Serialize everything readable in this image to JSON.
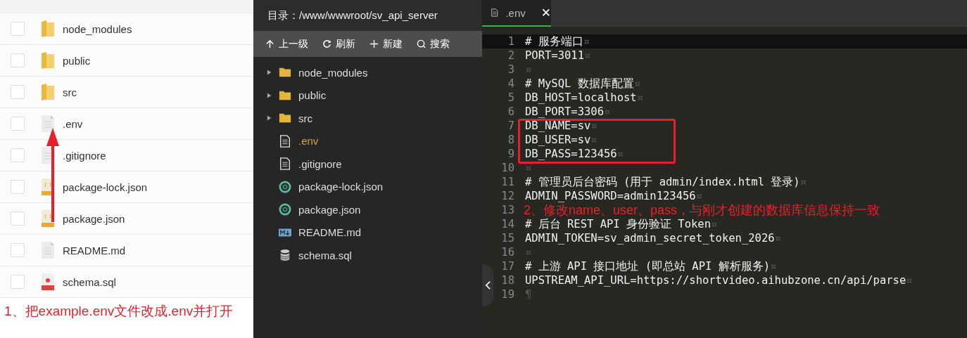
{
  "file_list": {
    "rows": [
      {
        "name": "node_modules",
        "kind": "folder",
        "checked": false
      },
      {
        "name": "public",
        "kind": "folder",
        "checked": false
      },
      {
        "name": "src",
        "kind": "folder",
        "checked": false
      },
      {
        "name": ".env",
        "kind": "text",
        "checked": false
      },
      {
        "name": ".gitignore",
        "kind": "text",
        "checked": false
      },
      {
        "name": "package-lock.json",
        "kind": "json",
        "checked": false
      },
      {
        "name": "package.json",
        "kind": "json",
        "checked": false
      },
      {
        "name": "README.md",
        "kind": "text",
        "checked": false
      },
      {
        "name": "schema.sql",
        "kind": "sql",
        "checked": false
      }
    ]
  },
  "explorer": {
    "path": "目录：/www/wwwroot/sv_api_server",
    "toolbar": [
      {
        "label": "上一级",
        "kind": "up"
      },
      {
        "label": "刷新",
        "kind": "refresh"
      },
      {
        "label": "新建",
        "kind": "new"
      },
      {
        "label": "搜索",
        "kind": "search"
      }
    ],
    "items": [
      {
        "name": "node_modules",
        "kind": "folder",
        "selected": false
      },
      {
        "name": "public",
        "kind": "folder",
        "selected": false
      },
      {
        "name": "src",
        "kind": "folder",
        "selected": false
      },
      {
        "name": ".env",
        "kind": "text",
        "selected": true
      },
      {
        "name": ".gitignore",
        "kind": "text",
        "selected": false
      },
      {
        "name": "package-lock.json",
        "kind": "json",
        "selected": false
      },
      {
        "name": "package.json",
        "kind": "json",
        "selected": false
      },
      {
        "name": "README.md",
        "kind": "markdown",
        "selected": false
      },
      {
        "name": "schema.sql",
        "kind": "database",
        "selected": false
      }
    ]
  },
  "editor": {
    "tab": {
      "title": ".env",
      "close": "✕"
    },
    "lines": [
      {
        "number": "1",
        "text": "# 服务端口",
        "eol": "¤",
        "current": true
      },
      {
        "number": "2",
        "text": "PORT=3011",
        "eol": "¤",
        "current": false
      },
      {
        "number": "3",
        "eol": "¤",
        "current": false
      },
      {
        "number": "4",
        "text": "# MySQL 数据库配置",
        "eol": "¤",
        "current": false
      },
      {
        "number": "5",
        "text": "DB_HOST=localhost",
        "eol": "¤",
        "current": false
      },
      {
        "number": "6",
        "text": "DB_PORT=3306",
        "eol": "¤",
        "current": false
      },
      {
        "number": "7",
        "text": "DB_NAME=sv",
        "eol": "¤",
        "current": false
      },
      {
        "number": "8",
        "text": "DB_USER=sv",
        "eol": "¤",
        "current": false
      },
      {
        "number": "9",
        "text": "DB_PASS=123456",
        "eol": "¤",
        "current": false
      },
      {
        "number": "10",
        "eol": "¤",
        "current": false
      },
      {
        "number": "11",
        "text": "# 管理员后台密码 (用于 admin/index.html 登录)",
        "eol": "¤",
        "current": false
      },
      {
        "number": "12",
        "text": "ADMIN_PASSWORD=admin123456",
        "eol": "¤",
        "current": false
      },
      {
        "number": "13",
        "current": false
      },
      {
        "number": "14",
        "text": "# 后台 REST API 身份验证 Token",
        "eol": "¤",
        "current": false
      },
      {
        "number": "15",
        "text": "ADMIN_TOKEN=sv_admin_secret_token_2026",
        "eol": "¤",
        "current": false
      },
      {
        "number": "16",
        "eol": "¤",
        "current": false
      },
      {
        "number": "17",
        "text": "# 上游 API 接口地址 (即总站 API 解析服务)",
        "eol": "¤",
        "current": false
      },
      {
        "number": "18",
        "text": "UPSTREAM_API_URL=https://shortvideo.aihubzone.cn/api/parse",
        "eol": "¤",
        "current": false
      },
      {
        "number": "19",
        "eol": "¶",
        "current": false
      }
    ]
  },
  "annotations": [
    {
      "text": "1、把example.env文件改成.env并打开"
    },
    {
      "text": "2、修改name、user、pass，与刚才创建的数据库信息保持一致"
    }
  ]
}
